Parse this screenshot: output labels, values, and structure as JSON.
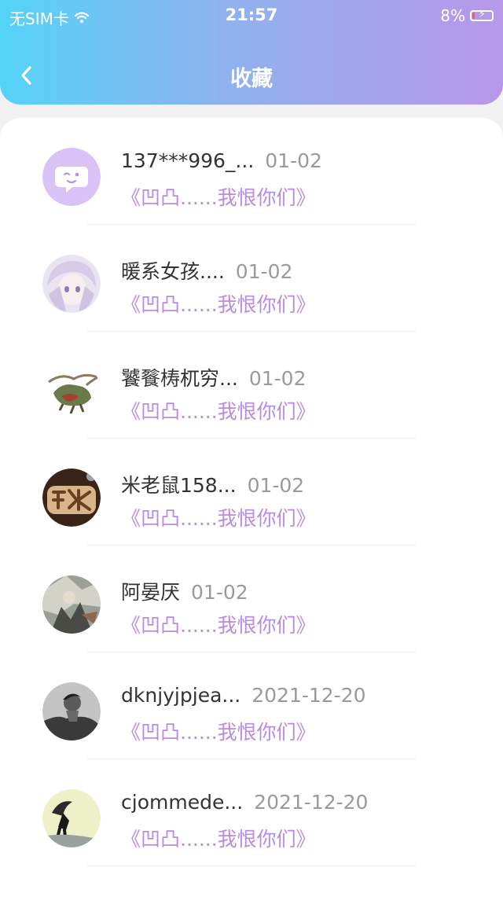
{
  "status_bar": {
    "carrier": "无SIM卡",
    "time": "21:57",
    "battery": "8%"
  },
  "header": {
    "title": "收藏"
  },
  "favorites": [
    {
      "name": "137***996_...",
      "date": "01-02",
      "title": "《凹凸......我恨你们》",
      "avatar": "chat-bubble-icon"
    },
    {
      "name": "暖系女孩....",
      "date": "01-02",
      "title": "《凹凸......我恨你们》",
      "avatar": "anime-girl"
    },
    {
      "name": "饕餮梼杌穷...",
      "date": "01-02",
      "title": "《凹凸......我恨你们》",
      "avatar": "mythical-beast"
    },
    {
      "name": "米老鼠158...",
      "date": "01-02",
      "title": "《凹凸......我恨你们》",
      "avatar": "wooden-char"
    },
    {
      "name": "阿晏厌",
      "date": "01-02",
      "title": "《凹凸......我恨你们》",
      "avatar": "illustration"
    },
    {
      "name": "dknjyjpjea...",
      "date": "2021-12-20",
      "title": "《凹凸......我恨你们》",
      "avatar": "photo-bw"
    },
    {
      "name": "cjommede...",
      "date": "2021-12-20",
      "title": "《凹凸......我恨你们》",
      "avatar": "umbrella-figure"
    }
  ]
}
